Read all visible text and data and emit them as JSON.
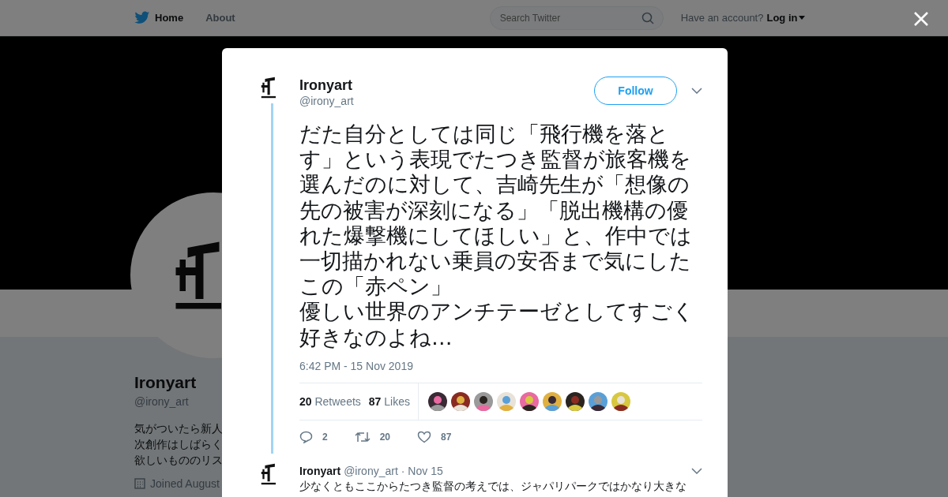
{
  "topbar": {
    "nav": [
      {
        "label": "Home",
        "selected": true
      },
      {
        "label": "About",
        "selected": false
      }
    ],
    "search": {
      "placeholder": "Search Twitter"
    },
    "account_prompt": "Have an account?",
    "login": "Log in"
  },
  "profile": {
    "name": "Ironyart",
    "handle": "@irony_art",
    "bio_lines": [
      "気がついたら新人",
      "次創作はしばらく",
      "欲しいもののリス"
    ],
    "joined": "Joined August"
  },
  "tweet": {
    "name": "Ironyart",
    "handle": "@irony_art",
    "follow": "Follow",
    "text": [
      "だた自分としては同じ「飛行機を落とす」という表現でたつき監督が旅客機を選んだのに対して、吉崎先生が「想像の先の被害が深刻になる」「脱出機構の優れた爆撃機にしてほしい」と、作中では一切描かれない乗員の安否まで気にしたこの「赤ペン」",
      "優しい世界のアンチテーゼとしてすごく好きなのよね…"
    ],
    "time": "6:42 PM - 15 Nov 2019",
    "retweets": {
      "count": "20",
      "label": "Retweets"
    },
    "likes": {
      "count": "87",
      "label": "Likes"
    },
    "liked_by": [
      {
        "kind": "picture"
      },
      {
        "kind": "picture"
      },
      {
        "kind": "picture"
      },
      {
        "kind": "picture"
      },
      {
        "kind": "picture"
      },
      {
        "kind": "picture"
      },
      {
        "kind": "picture"
      },
      {
        "kind": "picture"
      },
      {
        "kind": "picture"
      }
    ],
    "actions": [
      {
        "kind": "reply",
        "count": "2"
      },
      {
        "kind": "retweet",
        "count": "20"
      },
      {
        "kind": "like",
        "count": "87"
      }
    ]
  },
  "next_tweet": {
    "name": "Ironyart",
    "handle": "@irony_art",
    "date": "· Nov 15",
    "text": "少なくともここからたつき監督の考えでは、ジャパリパークではかなり大きな"
  }
}
